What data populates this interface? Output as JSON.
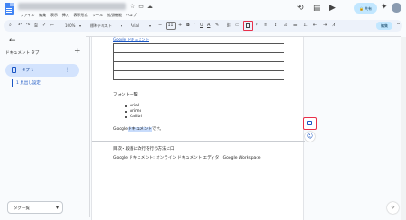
{
  "app": {
    "menus": [
      "ファイル",
      "編集",
      "表示",
      "挿入",
      "表示形式",
      "ツール",
      "拡張機能",
      "ヘルプ"
    ],
    "share_label": "共有"
  },
  "toolbar": {
    "zoom": "100%",
    "style": "標準テキスト",
    "font": "Arial",
    "font_size": "11",
    "mode": "編集"
  },
  "sidebar": {
    "heading": "ドキュメント タブ",
    "tab_label": "タブ 1",
    "outline_item": "1 見出し設定",
    "bottom_select": "タグ一覧"
  },
  "document": {
    "link_text": "Google ドキュメント",
    "section_heading": "フォント一覧",
    "bullets": [
      "Arial",
      "Arimo",
      "Calibri"
    ],
    "body_prefix": "Google",
    "body_highlight": "ドキュメント",
    "body_suffix": "です。",
    "footer_heading": "目次・段落に改行を行う方法に口",
    "footer_text": "Google ドキュメント: オンライン ドキュメント エディタ | Google Workspace"
  },
  "colors": {
    "accent": "#1a56c4",
    "highlight_box": "#e8304a",
    "toolbar_bg": "#edf2fa",
    "selected_tab": "#d3e3fd",
    "share_button": "#c2e7ff"
  }
}
